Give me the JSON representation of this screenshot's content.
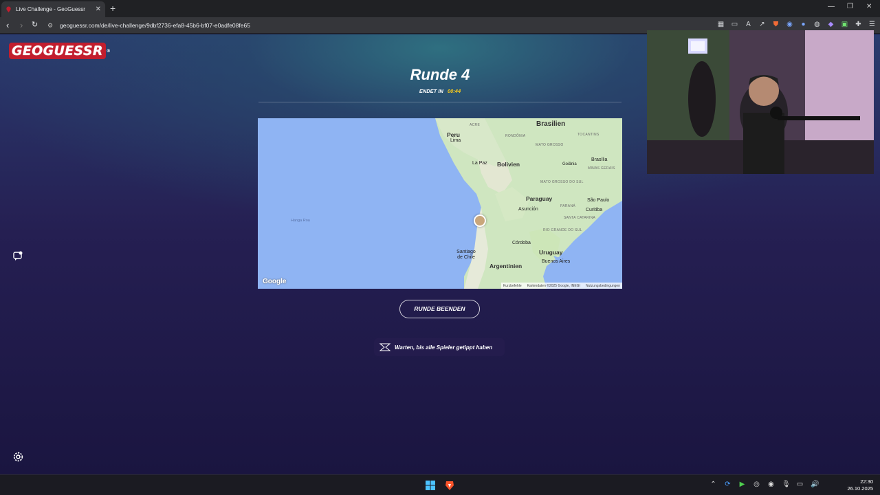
{
  "browser": {
    "tab_title": "Live Challenge - GeoGuessr",
    "new_tab_symbol": "+",
    "url": "geoguessr.com/de/live-challenge/9dbf2736-efa8-45b6-bf07-e0adfe08fe65"
  },
  "game": {
    "logo_text": "GEOGUESSR",
    "round_title": "Runde 4",
    "timer_label": "ENDET IN",
    "timer_value": "00:44",
    "end_round_button": "RUNDE BEENDEN",
    "waiting_message": "Warten, bis alle Spieler getippt haben"
  },
  "map": {
    "labels": {
      "brasilien": "Brasilien",
      "peru": "Peru",
      "lima": "Lima",
      "la_paz": "La Paz",
      "bolivien": "Bolivien",
      "paraguay": "Paraguay",
      "asuncion": "Asunción",
      "sao_paulo": "São Paulo",
      "curitiba": "Curitiba",
      "brasilia": "Brasília",
      "goiania": "Goiânia",
      "santiago": "Santiago de Chile",
      "cordoba": "Córdoba",
      "uruguay": "Uruguay",
      "buenos_aires": "Buenos Aires",
      "argentinien": "Argentinien",
      "hanga_roa": "Hanga Roa",
      "acre": "ACRE",
      "rondonia": "RONDÔNIA",
      "tocantins": "TOCANTINS",
      "mato_grosso": "MATO GROSSO",
      "minas_gerais": "MINAS GERAIS",
      "mato_grosso_sul": "MATO GROSSO DO SUL",
      "parana": "PARANÁ",
      "santa_catarina": "SANTA CATARINA",
      "rio_grande_sul": "RIO GRANDE DO SUL"
    },
    "google_logo": "Google",
    "attribution": {
      "shortcuts": "Kurzbefehle",
      "map_data": "Kartendaten ©2025 Google, INEGI",
      "terms": "Nutzungsbedingungen"
    }
  },
  "taskbar": {
    "time": "22:30",
    "date": "26.10.2025"
  },
  "colors": {
    "brand_red": "#c21e2e",
    "timer_yellow": "#fecd19",
    "ocean": "#8fb4f3",
    "land": "#cfe6c0"
  }
}
